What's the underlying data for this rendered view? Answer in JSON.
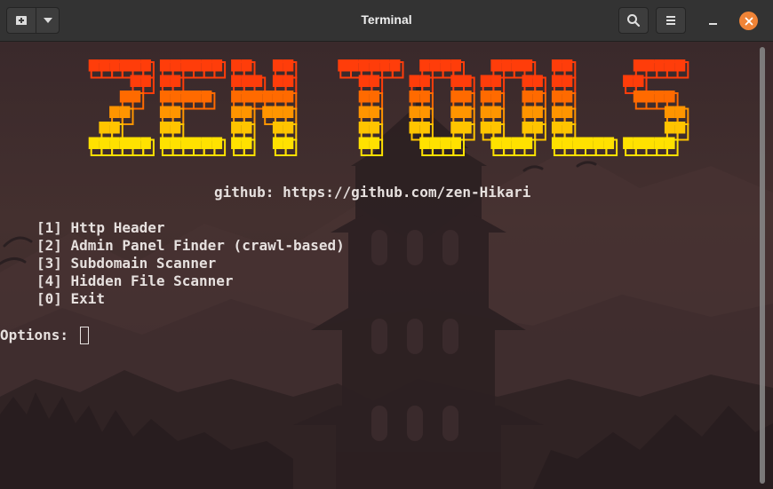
{
  "window": {
    "title": "Terminal"
  },
  "header": {
    "new_tab_icon": "new-tab-icon",
    "tab_menu_icon": "chevron-down-icon",
    "search_icon": "search-icon",
    "menu_icon": "hamburger-icon",
    "minimize_icon": "minimize-icon",
    "close_icon": "close-icon",
    "close_color": "#f08437"
  },
  "terminal": {
    "banner_text": "ZEN TOOLS",
    "banner_colors": [
      "#ff3d0a",
      "#ff6a00",
      "#ff9500",
      "#ffc400",
      "#ffe100"
    ],
    "github_line": "github: https://github.com/zen-Hikari",
    "menu": [
      "[1] Http Header",
      "[2] Admin Panel Finder (crawl-based)",
      "[3] Subdomain Scanner",
      "[4] Hidden File Scanner",
      "[0] Exit"
    ],
    "prompt": "Options: "
  }
}
